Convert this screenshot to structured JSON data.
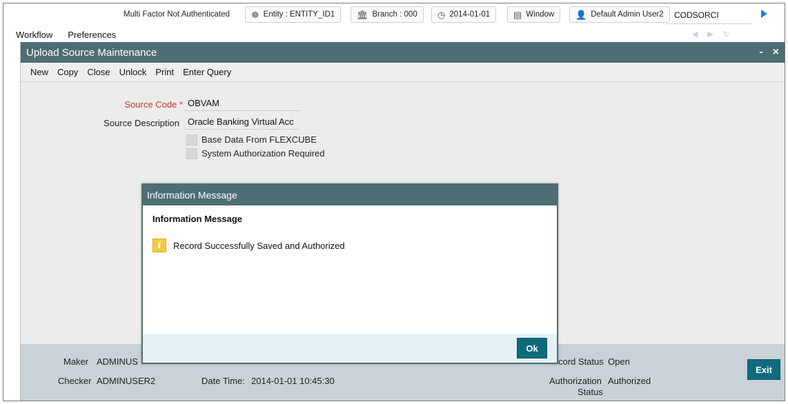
{
  "topbar": {
    "auth_status": "Multi Factor Not Authenticated",
    "entity": "Entity : ENTITY_ID1",
    "branch": "Branch : 000",
    "date": "2014-01-01",
    "window": "Window",
    "user": "Default Admin User2",
    "user_code": "CODSORCI"
  },
  "menu": {
    "workflow": "Workflow",
    "preferences": "Preferences"
  },
  "window": {
    "title": "Upload Source Maintenance",
    "minimize": "-",
    "close": "×",
    "toolbar": {
      "new": "New",
      "copy": "Copy",
      "close": "Close",
      "unlock": "Unlock",
      "print": "Print",
      "enter_query": "Enter Query"
    },
    "form": {
      "source_code_label": "Source Code",
      "required_mark": "*",
      "source_code_value": "OBVAM",
      "source_description_label": "Source Description",
      "source_description_value": "Oracle Banking Virtual Acc",
      "base_data_label": "Base Data From FLEXCUBE",
      "system_auth_label": "System Authorization Required"
    },
    "footer": {
      "maker_label": "Maker",
      "maker_value": "ADMINUS",
      "checker_label": "Checker",
      "checker_value": "ADMINUSER2",
      "datetime_label": "Date Time:",
      "datetime_value": "2014-01-01 10:45:30",
      "record_status_label": "cord Status",
      "record_status_value": "Open",
      "auth_status_label_1": "Authorization",
      "auth_status_label_2": "Status",
      "auth_status_value": "Authorized",
      "exit": "Exit"
    }
  },
  "modal": {
    "title": "Information Message",
    "heading": "Information Message",
    "message": "Record Successfully Saved and Authorized",
    "ok": "Ok"
  }
}
